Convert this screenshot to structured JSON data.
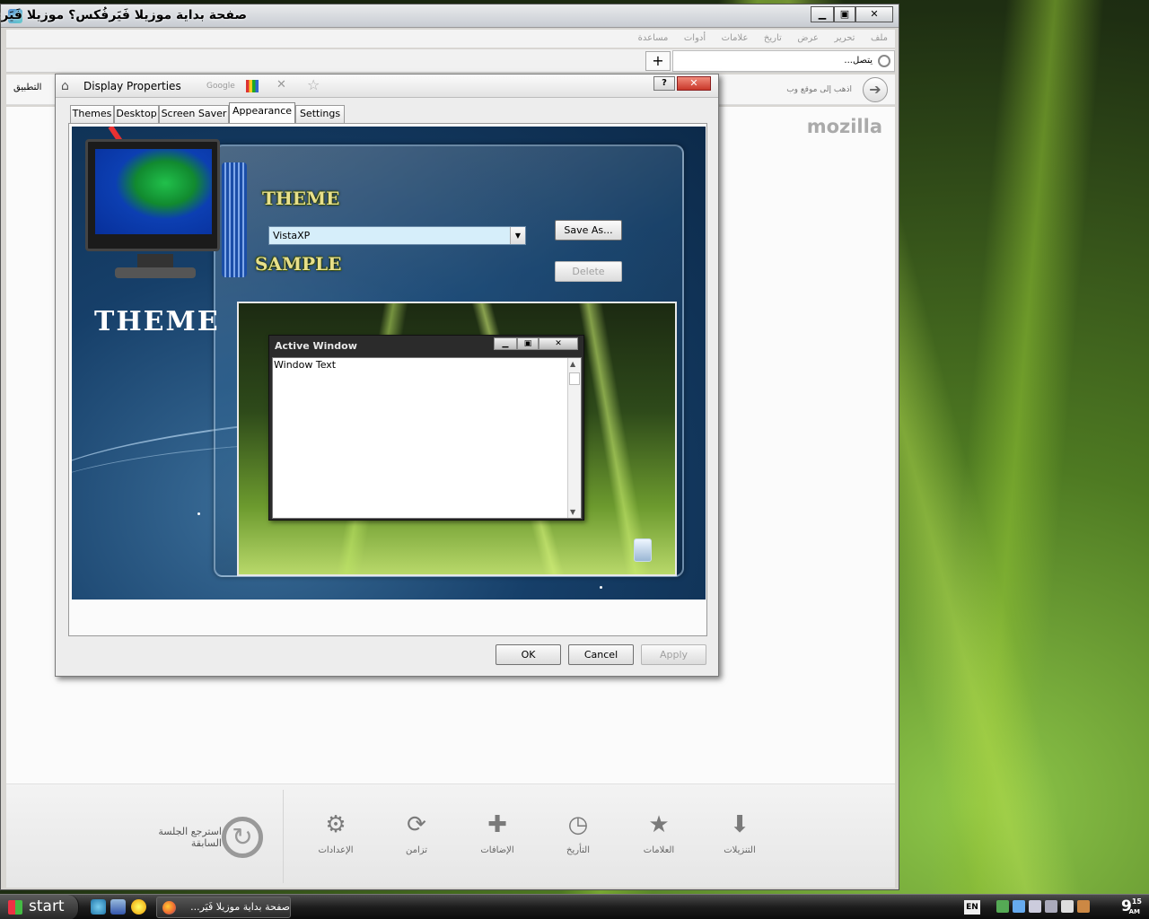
{
  "firefox": {
    "title": "صفحة بداية موزيلا فَيَرفُكس؟ موزيلا فَيَرفُكس",
    "menu": [
      "ملف",
      "تحرير",
      "عرض",
      "تاريخ",
      "علامات",
      "أدوات",
      "مساعدة"
    ],
    "new_tab": "+",
    "current_tab": "يتصل...",
    "nav_address": "اذهب إلى موقع وب",
    "apply_left": "التطبيق",
    "brand": "mozilla",
    "launcher": {
      "restore_session": "استرجع الجلسة السابقة",
      "items": [
        {
          "label": "الإعدادات",
          "icon": "gear-icon",
          "glyph": "⚙"
        },
        {
          "label": "تزامن",
          "icon": "sync-icon",
          "glyph": "⟳"
        },
        {
          "label": "الإضافات",
          "icon": "puzzle-icon",
          "glyph": "✚"
        },
        {
          "label": "التأريخ",
          "icon": "clock-icon",
          "glyph": "◷"
        },
        {
          "label": "العلامات",
          "icon": "star-icon",
          "glyph": "★"
        },
        {
          "label": "التنزيلات",
          "icon": "download-icon",
          "glyph": "⬇"
        }
      ]
    }
  },
  "dialog": {
    "title": "Display Properties",
    "search_engine": "Google",
    "help": "?",
    "close": "✕",
    "tabs": [
      "Themes",
      "Desktop",
      "Screen Saver",
      "Appearance",
      "Settings"
    ],
    "selected_tab": "Appearance",
    "theme_heading": "THEME",
    "sample_heading": "SAMPLE",
    "side_heading": "THEME",
    "theme_value": "VistaXP",
    "save_as": "Save As...",
    "delete": "Delete",
    "preview": {
      "window_title": "Active Window",
      "window_text": "Window Text"
    },
    "ok": "OK",
    "cancel": "Cancel",
    "apply": "Apply"
  },
  "taskbar": {
    "start": "start",
    "task_label": "صفحة بداية موزيلا فَيَر...",
    "language": "EN",
    "time": "9",
    "time_min": "15",
    "ampm": "AM"
  }
}
